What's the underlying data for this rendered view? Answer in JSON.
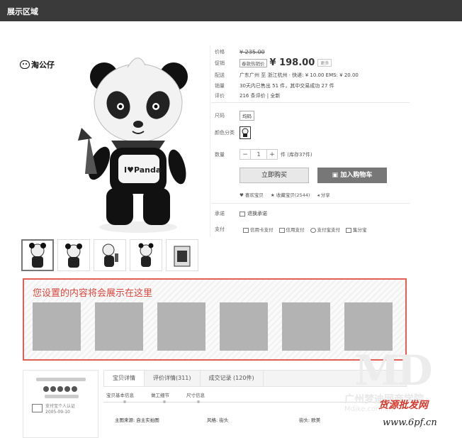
{
  "header": {
    "title": "展示区域"
  },
  "brand": {
    "name": "淘公仔"
  },
  "product": {
    "price_label": "价格",
    "original_price": "¥ 235.00",
    "promo_label": "促销",
    "promo_tag": "春款热销价",
    "promo_price": "¥ 198.00",
    "more_label": "更多",
    "shipping_label": "配送",
    "shipping_text": "广东广州 至 浙江杭州 ·  快递: ¥ 10.00   EMS: ¥ 20.00",
    "sales_label": "销量",
    "sales_text": "30天内已售出 51 件，其中交易成功 27 件",
    "review_label": "评价",
    "review_text": "216 条评价 | 全新",
    "size_label": "尺码",
    "size_value": "均码",
    "color_label": "颜色分类",
    "qty_label": "数量",
    "qty_minus": "−",
    "qty_value": "1",
    "qty_plus": "+",
    "stock_text": "件 (库存37件)",
    "buy_now": "立即购买",
    "add_cart": "加入购物车",
    "like": "喜欢宝贝",
    "favorite": "收藏宝贝(2544)",
    "share": "分享",
    "promise_label": "承诺",
    "promise_value": "退换承诺",
    "pay_label": "支付",
    "pay_options": [
      "信用卡支付",
      "信用支付",
      "支付宝支付",
      "集分宝"
    ]
  },
  "custom_area": {
    "message": "您设置的内容将会展示在这里"
  },
  "shop": {
    "cert_text": "支付宝个人认证",
    "cert_date": "2005-09-10"
  },
  "tabs": [
    "宝贝详情",
    "评价详情(311)",
    "成交记录 (120件)"
  ],
  "subtabs": [
    "宝贝基本信息",
    "做工细节",
    "尺寸信息"
  ],
  "attributes": [
    "主图来源: 自主实拍图",
    "风格: 街头",
    "街头: 欧美"
  ],
  "watermark": {
    "line1": "广州梦迪网商学院",
    "line2": "Mdike.com.cn",
    "line3": "货源批发网",
    "line4": "www.6pf.cn"
  },
  "colors": {
    "accent_red": "#e25f55",
    "topbar": "#3a3a3a",
    "cart_button": "#777777"
  }
}
